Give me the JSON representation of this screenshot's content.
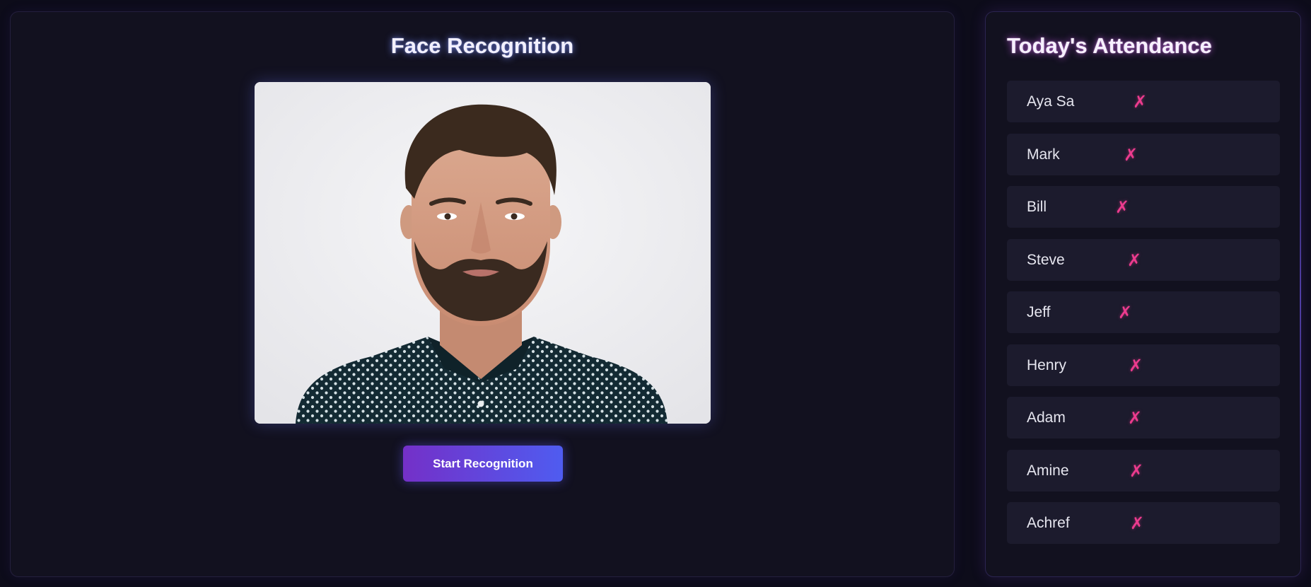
{
  "recognition": {
    "title": "Face Recognition",
    "start_button_label": "Start Recognition",
    "camera_feed": {
      "subject": "man with beard in polka-dot dark shirt",
      "background_color": "#eeeef0"
    }
  },
  "attendance": {
    "title": "Today's Attendance",
    "absent_symbol": "✗",
    "absent_color": "#ec3b8e",
    "items": [
      {
        "name": "Aya Sa",
        "status": "✗"
      },
      {
        "name": "Mark",
        "status": "✗"
      },
      {
        "name": "Bill",
        "status": "✗"
      },
      {
        "name": "Steve",
        "status": "✗"
      },
      {
        "name": "Jeff",
        "status": "✗"
      },
      {
        "name": "Henry",
        "status": "✗"
      },
      {
        "name": "Adam",
        "status": "✗"
      },
      {
        "name": "Amine",
        "status": "✗"
      },
      {
        "name": "Achref",
        "status": "✗"
      }
    ]
  },
  "colors": {
    "page_background": "#0d0c1a",
    "panel_background": "#12111f",
    "item_background": "#1c1b2d",
    "button_gradient_start": "#7430c8",
    "button_gradient_end": "#4f5cf0"
  }
}
